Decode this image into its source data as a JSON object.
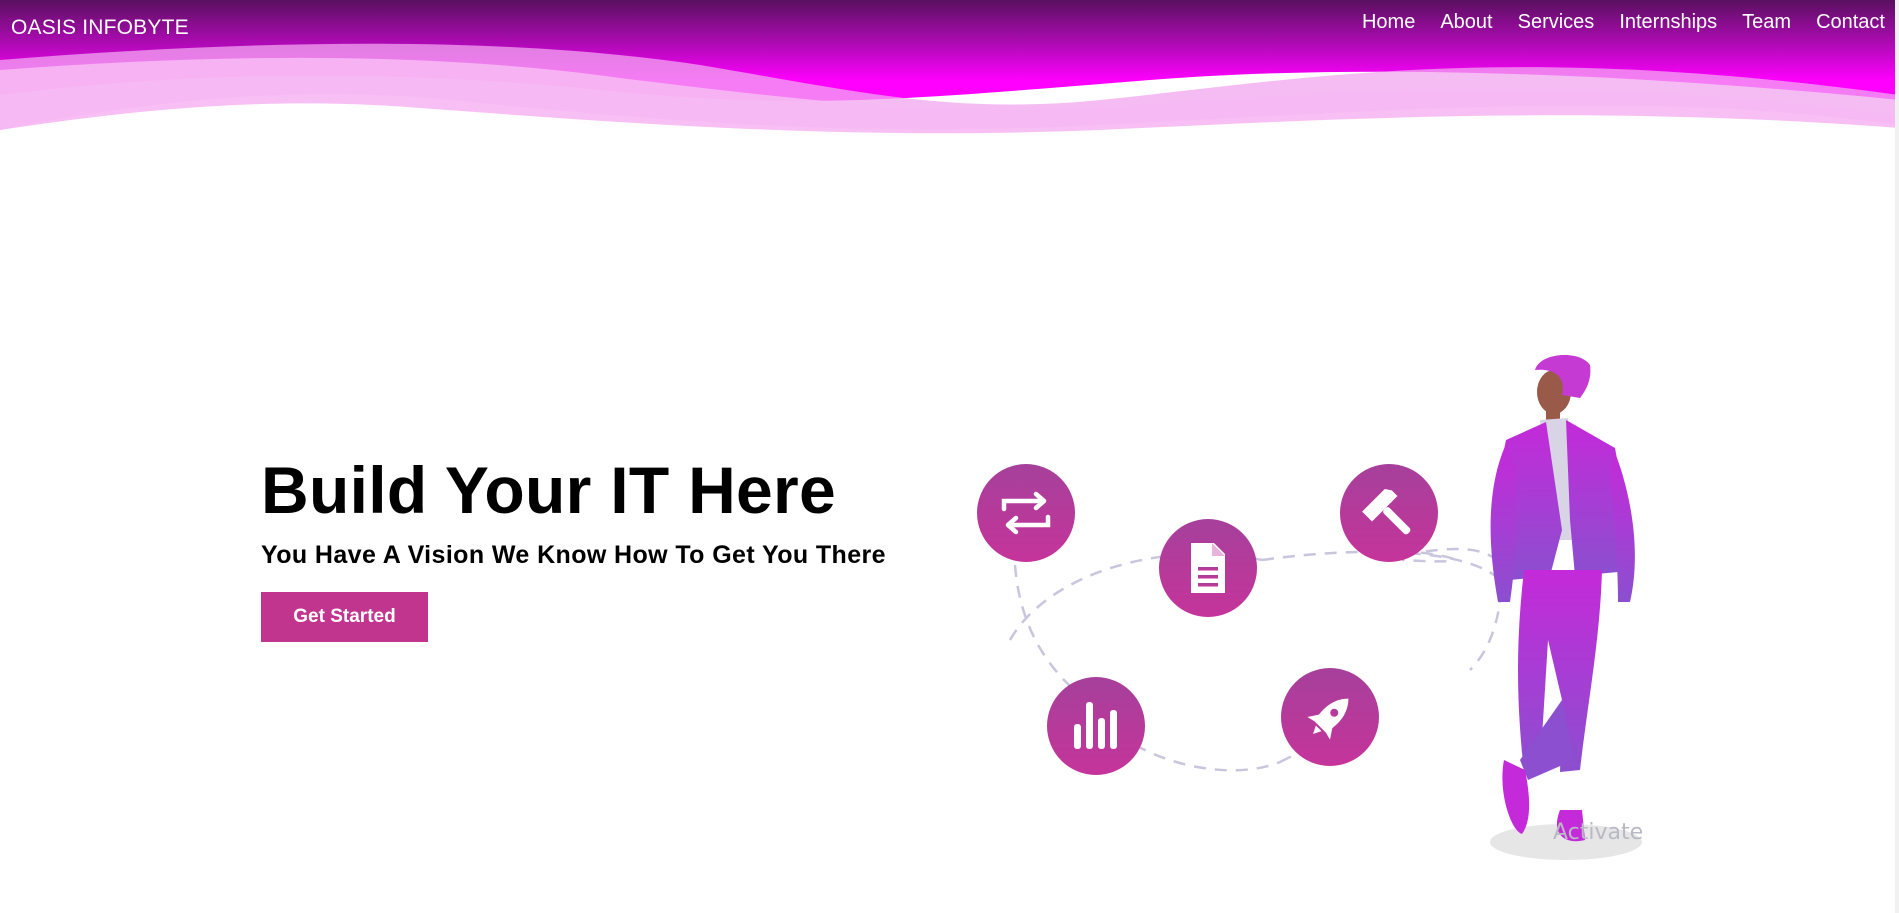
{
  "brand": {
    "name": "OASIS INFOBYTE"
  },
  "nav": {
    "items": [
      {
        "label": "Home"
      },
      {
        "label": "About"
      },
      {
        "label": "Services"
      },
      {
        "label": "Internships"
      },
      {
        "label": "Team"
      },
      {
        "label": "Contact"
      }
    ]
  },
  "hero": {
    "title": "Build Your IT Here",
    "subtitle": "You Have A Vision We Know How To Get You There",
    "cta_label": "Get Started"
  },
  "illustration": {
    "icons": [
      "repeat-icon",
      "document-icon",
      "hammer-icon",
      "bar-chart-icon",
      "rocket-icon"
    ]
  },
  "watermark": {
    "text": "Activate"
  },
  "colors": {
    "header_top": "#5a1060",
    "header_mid": "#ff00ff",
    "accent": "#c2358f",
    "icon_circle": "#b8389a",
    "figure_suit": "#c02ad8"
  }
}
